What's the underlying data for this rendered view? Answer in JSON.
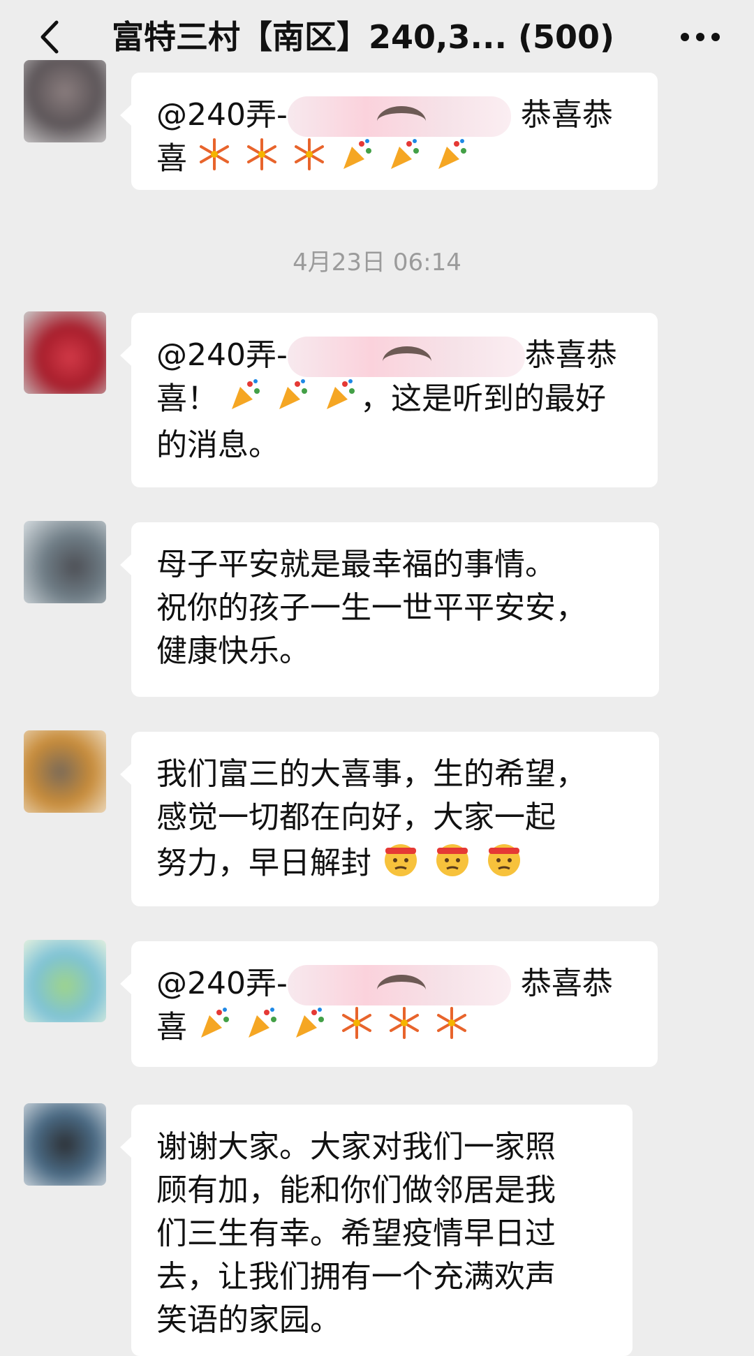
{
  "header": {
    "title": "富特三村【南区】240,3... (500)",
    "back_icon": "chevron-left-icon",
    "more_icon": "ellipsis-icon"
  },
  "timestamp": "4月23日 06:14",
  "messages": [
    {
      "lines": [
        "@240弄-",
        "恭喜恭",
        "喜"
      ],
      "emojis": [
        "fireworks",
        "fireworks",
        "fireworks",
        "party-popper",
        "party-popper",
        "party-popper"
      ]
    },
    {
      "lines": [
        "@240弄-",
        "恭喜恭",
        "喜！",
        "，这是听到的最好",
        "的消息。"
      ],
      "emojis": [
        "party-popper",
        "party-popper",
        "party-popper"
      ]
    },
    {
      "lines": [
        "母子平安就是最幸福的事情。",
        "祝你的孩子一生一世平平安安，",
        "健康快乐。"
      ]
    },
    {
      "lines": [
        "我们富三的大喜事，生的希望，",
        "感觉一切都在向好，大家一起",
        "努力，早日解封"
      ],
      "emojis": [
        "face-with-headband",
        "face-with-headband",
        "face-with-headband"
      ]
    },
    {
      "lines": [
        "@240弄-",
        "恭喜恭",
        "喜"
      ],
      "emojis": [
        "party-popper",
        "party-popper",
        "party-popper",
        "fireworks",
        "fireworks",
        "fireworks"
      ]
    },
    {
      "lines": [
        "谢谢大家。大家对我们一家照",
        "顾有加，能和你们做邻居是我",
        "们三生有幸。希望疫情早日过",
        "去，让我们拥有一个充满欢声",
        "笑语的家园。"
      ]
    }
  ],
  "colors": {
    "background": "#ededed",
    "bubble": "#ffffff",
    "timestamp_text": "#9b9b9b"
  }
}
